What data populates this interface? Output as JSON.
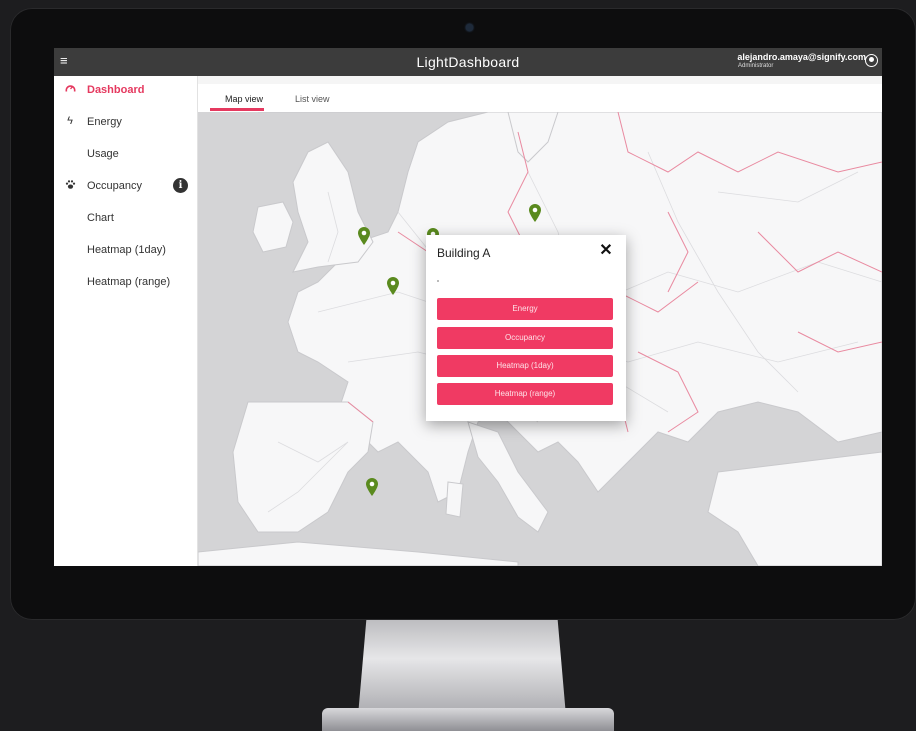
{
  "app": {
    "title": "LightDashboard",
    "accent_color": "#e5395f"
  },
  "header": {
    "menu_icon": "hamburger-icon",
    "user_email": "alejandro.amaya@signify.com",
    "user_role": "Administrator",
    "user_icon": "account-circle-icon"
  },
  "sidebar": {
    "items": [
      {
        "label": "Dashboard",
        "icon": "dashboard-gauge-icon",
        "active": true
      },
      {
        "label": "Energy",
        "icon": "lightning-icon"
      },
      {
        "label": "Usage",
        "icon": ""
      },
      {
        "label": "Occupancy",
        "icon": "paw-icon",
        "badge_icon": "info-icon"
      },
      {
        "label": "Chart",
        "icon": ""
      },
      {
        "label": "Heatmap (1day)",
        "icon": ""
      },
      {
        "label": "Heatmap (range)",
        "icon": ""
      }
    ]
  },
  "tabs": [
    {
      "label": "Map view",
      "active": true
    },
    {
      "label": "List view",
      "active": false
    }
  ],
  "map": {
    "pin_color": "#5a8a1e",
    "pin_icon": "map-pin-icon"
  },
  "dialog": {
    "title": "Building A",
    "close_icon": "close-icon",
    "buttons": [
      {
        "label": "Energy"
      },
      {
        "label": "Occupancy"
      },
      {
        "label": "Heatmap (1day)"
      },
      {
        "label": "Heatmap (range)"
      }
    ]
  }
}
